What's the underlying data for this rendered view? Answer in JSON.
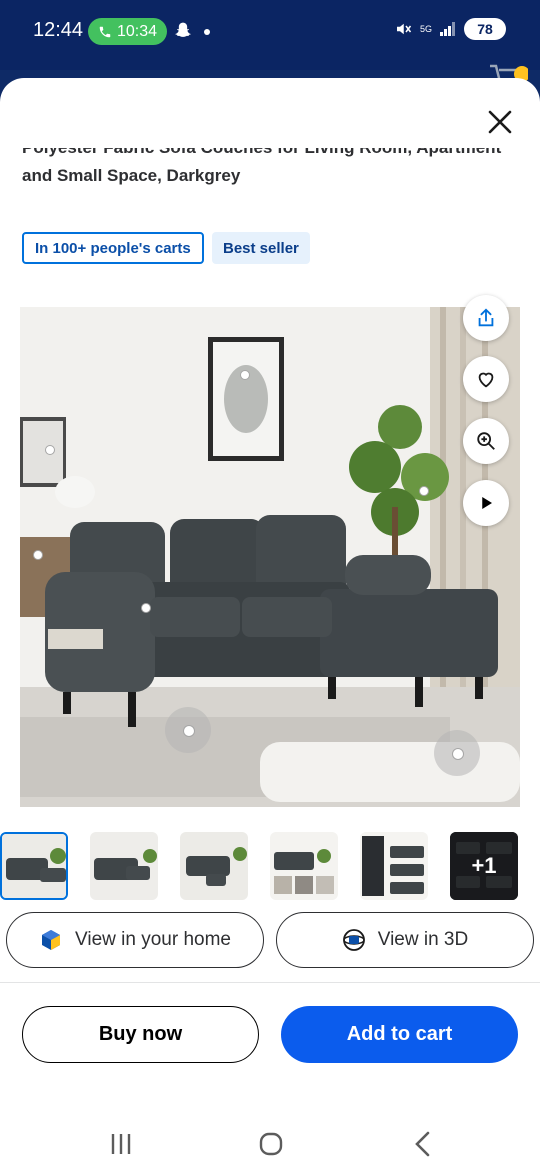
{
  "status_bar": {
    "time": "12:44",
    "call_time": "10:34",
    "network": "5G",
    "battery": "78"
  },
  "product": {
    "title_line1": "Polyester Fabric Sofa Couches for Living Room, Apartment",
    "title_line2": "and Small Space, Darkgrey"
  },
  "badges": {
    "carts": "In 100+ people's carts",
    "best_seller": "Best seller"
  },
  "image_actions": [
    "share-icon",
    "heart-icon",
    "zoom-in-icon",
    "play-icon"
  ],
  "thumbnails": {
    "count_shown": 6,
    "selected_index": 0,
    "more_label": "+1"
  },
  "actions": {
    "view_home": "View in your home",
    "view_3d": "View in 3D",
    "buy_now": "Buy now",
    "add_to_cart": "Add to cart"
  },
  "colors": {
    "brand_blue": "#0071dc",
    "header_navy": "#0b2563",
    "add_to_cart_blue": "#0b5ced",
    "call_green": "#43c15f"
  }
}
